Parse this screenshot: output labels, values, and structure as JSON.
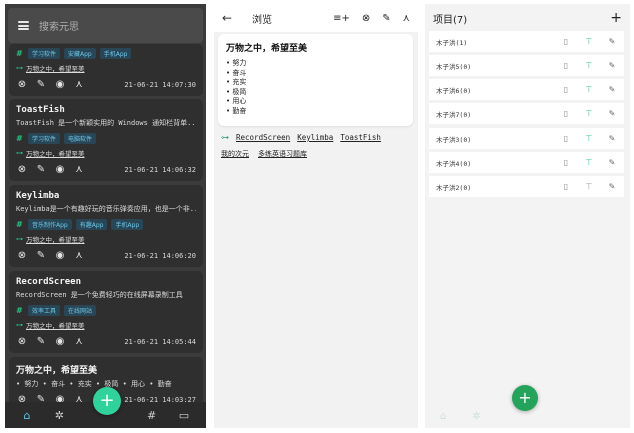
{
  "colors": {
    "accent": "#26c281",
    "tag_bg": "#284656",
    "tag_fg": "#6ec7e8",
    "dark_bg": "#3b3b3b",
    "fab": "#2fd29a"
  },
  "panel1": {
    "search_placeholder": "搜索元思",
    "cards": [
      {
        "title": "",
        "desc": "",
        "tags": [
          "学习软件",
          "安藏App",
          "手机App"
        ],
        "link": "万物之中，希望至美",
        "time": "21-06-21 14:07:30"
      },
      {
        "title": "ToastFish",
        "desc": "ToastFish 是一个新颖实用的 Windows 通知栏背单...",
        "tags": [
          "学习软件",
          "电脑软件"
        ],
        "link": "万物之中，希望至美",
        "time": "21-06-21 14:06:32"
      },
      {
        "title": "Keylimba",
        "desc": "Keylimba是一个有趣好玩的音乐弹奏应用，也是一个非...",
        "tags": [
          "音乐制作App",
          "有趣App",
          "手机App"
        ],
        "link": "万物之中，希望至美",
        "time": "21-06-21 14:06:20"
      },
      {
        "title": "RecordScreen",
        "desc": "RecordScreen 是一个免费轻巧的在线屏幕录制工具",
        "tags": [
          "效率工具",
          "在线网站"
        ],
        "link": "万物之中，希望至美",
        "time": "21-06-21 14:05:44"
      },
      {
        "title": "万物之中，希望至美",
        "desc": "• 努力 • 奋斗 • 充实 • 极简 • 用心 • 勤奋",
        "tags": [],
        "link": "",
        "time": "21-06-21 14:03:27"
      }
    ],
    "nav": [
      "home-icon",
      "explore-icon",
      "tag-icon",
      "folder-icon"
    ],
    "fab_label": "+"
  },
  "panel2": {
    "title": "浏览",
    "note_title": "万物之中，希望至美",
    "note_items": [
      "努力",
      "奋斗",
      "充实",
      "极简",
      "用心",
      "勤奋"
    ],
    "links": [
      "RecordScreen",
      "Keylimba",
      "ToastFish"
    ],
    "tags": [
      "我的次元",
      "多练英语习题库"
    ]
  },
  "panel3": {
    "title": "项目(7)",
    "add_label": "+",
    "rows": [
      {
        "name": "木子洪(1)",
        "pinned": false
      },
      {
        "name": "木子洪5(0)",
        "pinned": true
      },
      {
        "name": "木子洪6(0)",
        "pinned": true
      },
      {
        "name": "木子洪7(0)",
        "pinned": true
      },
      {
        "name": "木子洪3(0)",
        "pinned": true
      },
      {
        "name": "木子洪4(0)",
        "pinned": true
      },
      {
        "name": "木子洪2(0)",
        "pinned": false
      }
    ],
    "fab_label": "+"
  }
}
